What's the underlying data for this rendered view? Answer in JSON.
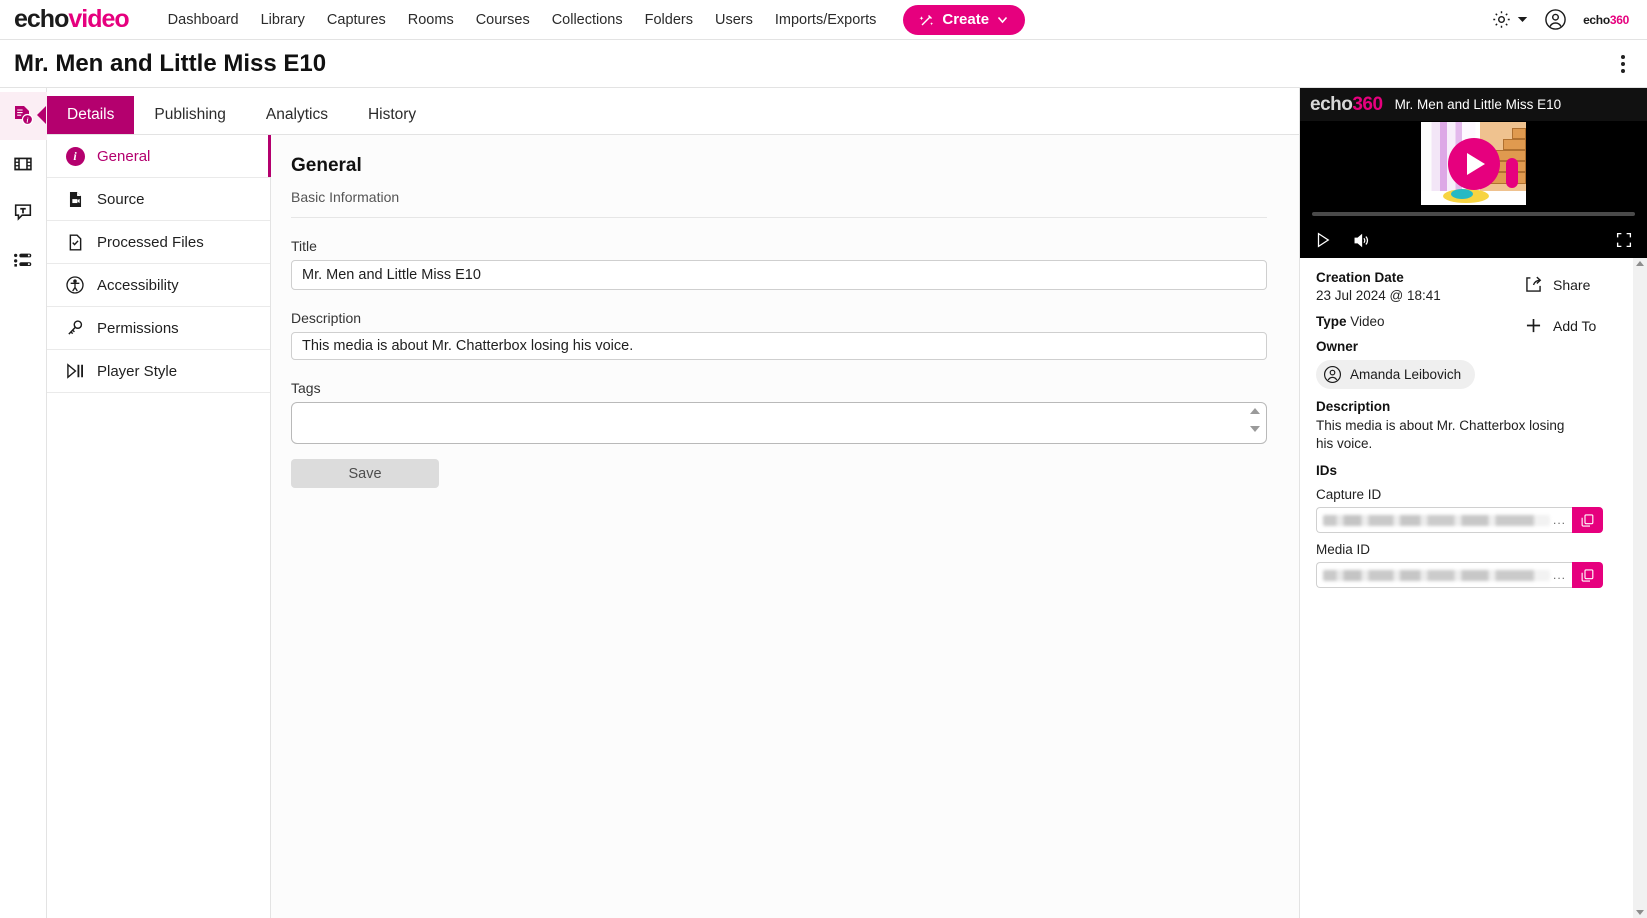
{
  "topnav": {
    "brand_echo": "echo",
    "brand_video": "video",
    "items": [
      {
        "label": "Dashboard"
      },
      {
        "label": "Library"
      },
      {
        "label": "Captures"
      },
      {
        "label": "Rooms"
      },
      {
        "label": "Courses"
      },
      {
        "label": "Collections"
      },
      {
        "label": "Folders"
      },
      {
        "label": "Users"
      },
      {
        "label": "Imports/Exports"
      }
    ],
    "create_label": "Create",
    "logo_echo": "echo",
    "logo_360": "360"
  },
  "titlebar": {
    "title": "Mr. Men and Little Miss E10"
  },
  "rail": {
    "items": [
      {
        "name": "details-icon",
        "active": true
      },
      {
        "name": "media-icon",
        "active": false
      },
      {
        "name": "transcript-icon",
        "active": false
      },
      {
        "name": "list-settings-icon",
        "active": false
      }
    ]
  },
  "tabs": [
    {
      "label": "Details",
      "active": true
    },
    {
      "label": "Publishing",
      "active": false
    },
    {
      "label": "Analytics",
      "active": false
    },
    {
      "label": "History",
      "active": false
    }
  ],
  "menu": {
    "items": [
      {
        "label": "General",
        "active": true
      },
      {
        "label": "Source",
        "active": false
      },
      {
        "label": "Processed Files",
        "active": false
      },
      {
        "label": "Accessibility",
        "active": false
      },
      {
        "label": "Permissions",
        "active": false
      },
      {
        "label": "Player Style",
        "active": false
      }
    ]
  },
  "form": {
    "heading": "General",
    "subheading": "Basic Information",
    "title_label": "Title",
    "title_value": "Mr. Men and Little Miss E10",
    "description_label": "Description",
    "description_value": "This media is about Mr. Chatterbox losing his voice.",
    "tags_label": "Tags",
    "tags_value": "",
    "save_label": "Save"
  },
  "player": {
    "logo_echo": "echo",
    "logo_360": "360",
    "title": "Mr. Men and Little Miss E10"
  },
  "meta": {
    "creation_date_label": "Creation Date",
    "creation_date_value": "23 Jul 2024 @ 18:41",
    "type_label": "Type",
    "type_value": "Video",
    "owner_label": "Owner",
    "owner_value": "Amanda Leibovich",
    "share_label": "Share",
    "add_to_label": "Add To",
    "description_label": "Description",
    "description_value": "This media is about Mr. Chatterbox losing his voice.",
    "ids_label": "IDs",
    "capture_id_label": "Capture ID",
    "capture_id_value": "",
    "media_id_label": "Media ID",
    "media_id_value": "",
    "ellipsis": "..."
  },
  "colors": {
    "brand_pink": "#e6007e",
    "accent_magenta": "#b4006e",
    "active_tab_bg": "#b4006e"
  }
}
